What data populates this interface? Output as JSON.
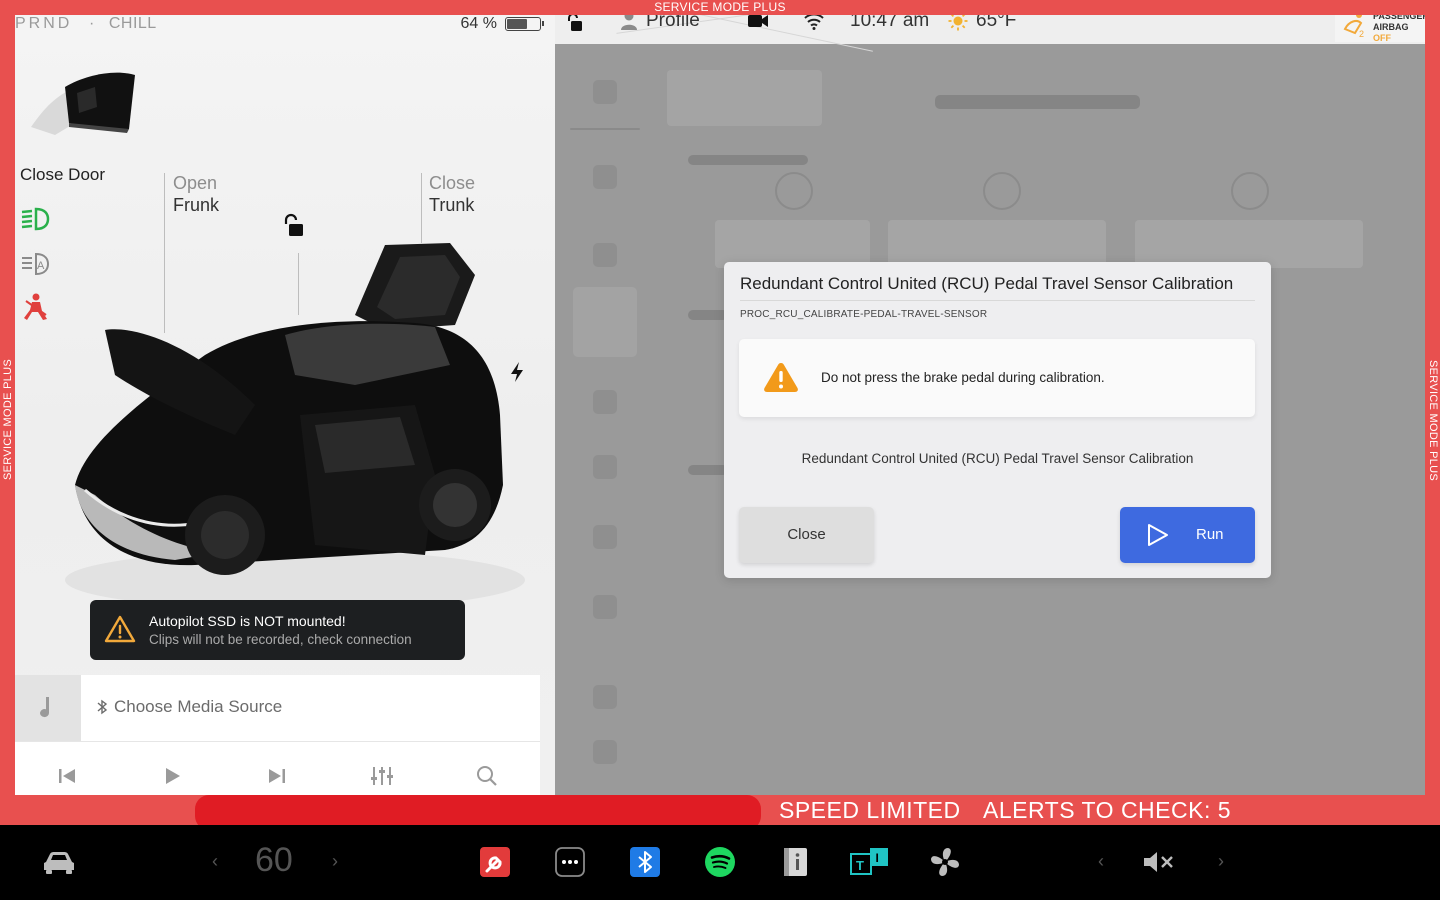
{
  "frame": {
    "top_label": "SERVICE MODE PLUS",
    "side_label": "SERVICE MODE PLUS",
    "color": "#e8504f"
  },
  "left": {
    "gear": "PRND",
    "drive_mode": "CHILL",
    "drive_mode_sep": "·",
    "battery_percent": "64 %",
    "battery_level": 0.64,
    "close_door": "Close Door",
    "frunk_line1": "Open",
    "frunk_line2": "Frunk",
    "trunk_line1": "Close",
    "trunk_line2": "Trunk",
    "side_icons": [
      "headlights-icon",
      "auto-headlights-icon",
      "seatbelt-warning-icon"
    ],
    "toast": {
      "title": "Autopilot SSD is NOT mounted!",
      "subtitle": "Clips will not be recorded, check connection"
    },
    "media": {
      "source_label": "Choose Media Source",
      "controls": [
        "previous-icon",
        "play-icon",
        "next-icon",
        "equalizer-icon",
        "search-icon"
      ]
    }
  },
  "status_bar": {
    "profile": "Profile",
    "time": "10:47 am",
    "temperature": "65°F",
    "airbag_line1": "PASSENGER",
    "airbag_line2": "AIRBAG",
    "airbag_state": "OFF",
    "airbag_state_color": "#f2a93b"
  },
  "modal": {
    "title": "Redundant Control United (RCU) Pedal Travel Sensor Calibration",
    "code": "PROC_RCU_CALIBRATE-PEDAL-TRAVEL-SENSOR",
    "warning": "Do not press the brake pedal during calibration.",
    "description": "Redundant Control United (RCU) Pedal Travel Sensor Calibration",
    "close_label": "Close",
    "run_label": "Run",
    "run_color": "#3e6ae0",
    "warning_color": "#f29a1a"
  },
  "alerts": {
    "speed_limited": "SPEED LIMITED",
    "alerts_to_check": "ALERTS TO CHECK: 5"
  },
  "taskbar": {
    "speed": "60",
    "chevron_left": "‹",
    "chevron_right": "›",
    "apps": [
      "car-icon",
      "service-wrench-icon",
      "more-apps-icon",
      "bluetooth-icon",
      "spotify-icon",
      "manual-icon",
      "teslamate-icon",
      "fan-icon",
      "volume-muted-icon"
    ]
  }
}
